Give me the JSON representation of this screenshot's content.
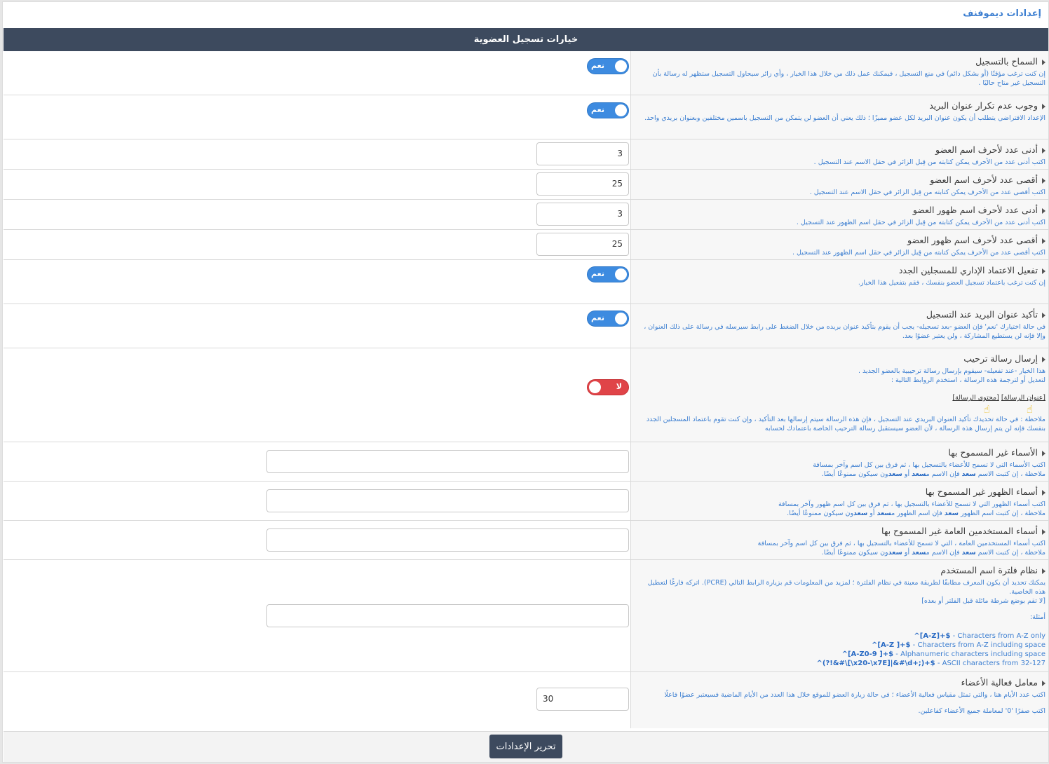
{
  "page_title": "إعدادات ديموفنف",
  "section_header": "خيارات تسجيل العضوية",
  "toggle_on_label": "نعم",
  "toggle_off_label": "لا",
  "rows": [
    {
      "title": "السماح بالتسجيل",
      "desc": "إن كنت ترغب مؤقتًا (أو بشكل دائم) في منع التسجيل ، فيمكنك عمل ذلك من خلال هذا الخيار ، وأي زائر سيحاول التسجيل ستظهر له رسالة بأن التسجيل غير متاح حاليًا .",
      "value": "نعم"
    },
    {
      "title": "وجوب عدم تكرار عنوان البريد",
      "desc": "الإعداد الافتراضي يتطلب أن يكون عنوان البريد لكل عضو مميزًا ؛ ذلك يعني أن العضو لن يتمكن من التسجيل باسمين مختلفين وبعنوان بريدي واحد.",
      "value": "نعم"
    },
    {
      "title": "أدنى عدد لأحرف اسم العضو",
      "desc": "اكتب أدنى عدد من الأحرف يمكن كتابته من قِبل الزائر في حقل الاسم عند التسجيل .",
      "value": "3"
    },
    {
      "title": "أقصى عدد لأحرف اسم العضو",
      "desc": "اكتب أقصى عدد من الأحرف يمكن كتابته من قِبل الزائر في حقل الاسم عند التسجيل .",
      "value": "25"
    },
    {
      "title": "أدنى عدد لأحرف اسم ظهور العضو",
      "desc": "اكتب أدنى عدد من الأحرف يمكن كتابته من قِبل الزائر في حقل اسم الظهور عند التسجيل .",
      "value": "3"
    },
    {
      "title": "أقصى عدد لأحرف اسم ظهور العضو",
      "desc": "اكتب أقصى عدد من الأحرف يمكن كتابته من قِبل الزائر في حقل اسم الظهور عند التسجيل .",
      "value": "25"
    },
    {
      "title": "تفعيل الاعتماد الإداري للمسجلين الجدد",
      "desc": "إن كنت ترغب باعتماد تسجيل العضو بنفسك ، فقم بتفعيل هذا الخيار.",
      "value": "نعم"
    },
    {
      "title": "تأكيد عنوان البريد عند التسجيل",
      "desc": "في حالة اختيارك 'نعم' فإن العضو -بعد تسجيله- يجب أن يقوم بتأكيد عنوان بريده من خلال الضغط على رابط سيرسله في رسالة على ذلك العنوان ، وإلا فإنه لن يستطيع المشاركة ، ولن يعتبر عضوًا بعد.",
      "value": "نعم"
    },
    {
      "title": "إرسال رسالة ترحيب",
      "desc": "هذا الخيار -عند تفعيله- سيقوم بإرسال رسالة ترحيبية بالعضو الجديد .",
      "desc2": "لتعديل أو لترجمة هذه الرسالة ، استخدم الروابط التالية :",
      "link1": "[عنوان الرسالة]",
      "link2": "[محتوى الرسالة]",
      "note": "ملاحظة : في حالة تحديدك تأكيد العنوان البريدي عند التسجيل ، فإن هذه الرسالة سيتم إرسالها بعد التأكيد ، وإن كنت تقوم باعتماد المسجلين الجدد بنفسك فإنه لن يتم إرسال هذه الرسالة ، لأن العضو سيستقبل رسالة الترحيب الخاصة باعتمادك لحسابه",
      "value": "لا"
    },
    {
      "title": "الأسماء غير المسموح بها",
      "desc": "اكتب الأسماء التي لا تسمح للأعضاء بالتسجيل بها ، ثم فرق بين كل اسم وآخر بمسافة",
      "note_pre": "ملاحظة ، إن كتبت الاسم ",
      "note_b1": "سعد",
      "note_mid": " فإن الاسم م",
      "note_b2": "سعد",
      "note_or": " أو ",
      "note_b3": "سعد",
      "note_end": "ون سيكون ممنوعًا أيضًا."
    },
    {
      "title": "أسماء الظهور غير المسموح بها",
      "desc": "اكتب أسماء الظهور التي لا تسمح للأعضاء بالتسجيل بها ، ثم فرق بين كل اسم ظهور وآخر بمسافة",
      "note_pre": "ملاحظة ، إن كتبت اسم الظهور ",
      "note_b1": "سعد",
      "note_mid": " فإن اسم الظهور م",
      "note_b2": "سعد",
      "note_or": " أو ",
      "note_b3": "سعد",
      "note_end": "ون سيكون ممنوعًا أيضًا."
    },
    {
      "title": "أسماء المستخدمين العامة غير المسموح بها",
      "desc": "اكتب أسماء المستخدمين العامة ، التي لا تسمح للأعضاء بالتسجيل بها ، ثم فرق بين كل اسم وآخر بمسافة",
      "note_pre": "ملاحظة ، إن كتبت الاسم ",
      "note_b1": "سعد",
      "note_mid": " فإن الاسم م",
      "note_b2": "سعد",
      "note_or": " أو ",
      "note_b3": "سعد",
      "note_end": "ون سيكون ممنوعًا أيضًا."
    },
    {
      "title": "نظام فلترة اسم المستخدم",
      "desc": "يمكنك تحديد أن يكون المعرف مطابقًا لطريقة معينة في نظام الفلترة ؛ لمزيد من المعلومات قم بزيارة الرابط التالي (PCRE). اتركه فارغًا لتعطيل هذه الخاصية.",
      "desc2": "[لا تقم بوضع شرطة مائلة قبل الفلتر أو بعده]",
      "examples_label": "أمثلة:",
      "examples": [
        {
          "code": "^[A-Z]+$",
          "text": " - Characters from A-Z only"
        },
        {
          "code": "^[A-Z ]+$",
          "text": " - Characters from A-Z including space"
        },
        {
          "code": "^[A-Z0-9 ]+$",
          "text": " - Alphanumeric characters including space"
        },
        {
          "code": "^(?!&#\\[\\x20-\\x7E]|&#\\d+;)+$",
          "text": " - ASCII characters from 32-127"
        }
      ]
    },
    {
      "title": "معامل فعالية الأعضاء",
      "desc": "اكتب عدد الأيام هنا ، والتي تمثل مقياس فعالية الأعضاء ؛ في حالة زيارة العضو للموقع خلال هذا العدد من الأيام الماضية فسيعتبر عضوًا فاعلًا",
      "desc2": "اكتب صفرًا '0' لمعاملة جميع الأعضاء كفاعلين.",
      "value": "30"
    }
  ],
  "submit_label": "تحرير الإعدادات"
}
